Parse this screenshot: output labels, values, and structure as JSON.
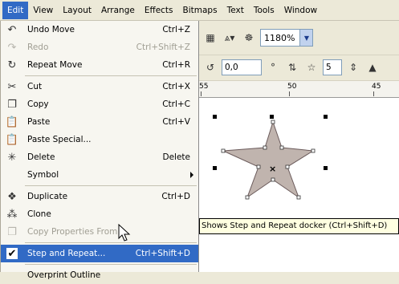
{
  "menubar": {
    "items": [
      "Edit",
      "View",
      "Layout",
      "Arrange",
      "Effects",
      "Bitmaps",
      "Text",
      "Tools",
      "Window"
    ],
    "active": "Edit"
  },
  "toolbar": {
    "zoom_value": "1180%",
    "angle_value": "0,0",
    "angle_unit": "°",
    "points_value": "5"
  },
  "ruler": {
    "labels": [
      "55",
      "50",
      "45"
    ]
  },
  "edit_menu": {
    "items": [
      {
        "label": "Undo Move",
        "shortcut": "Ctrl+Z",
        "icon": "undo-icon",
        "enabled": true
      },
      {
        "label": "Redo",
        "shortcut": "Ctrl+Shift+Z",
        "icon": "redo-icon",
        "enabled": false
      },
      {
        "label": "Repeat Move",
        "shortcut": "Ctrl+R",
        "icon": "repeat-icon",
        "enabled": true
      },
      {
        "label": "Cut",
        "shortcut": "Ctrl+X",
        "icon": "cut-icon",
        "enabled": true
      },
      {
        "label": "Copy",
        "shortcut": "Ctrl+C",
        "icon": "copy-icon",
        "enabled": true
      },
      {
        "label": "Paste",
        "shortcut": "Ctrl+V",
        "icon": "paste-icon",
        "enabled": true
      },
      {
        "label": "Paste Special...",
        "shortcut": "",
        "icon": "paste-special-icon",
        "enabled": true
      },
      {
        "label": "Delete",
        "shortcut": "Delete",
        "icon": "delete-icon",
        "enabled": true
      },
      {
        "label": "Symbol",
        "shortcut": "",
        "icon": "",
        "enabled": true,
        "submenu": true
      },
      {
        "label": "Duplicate",
        "shortcut": "Ctrl+D",
        "icon": "duplicate-icon",
        "enabled": true
      },
      {
        "label": "Clone",
        "shortcut": "",
        "icon": "clone-icon",
        "enabled": true
      },
      {
        "label": "Copy Properties From...",
        "shortcut": "",
        "icon": "copy-properties-icon",
        "enabled": false
      },
      {
        "label": "Step and Repeat...",
        "shortcut": "Ctrl+Shift+D",
        "icon": "check-icon",
        "enabled": true,
        "highlighted": true
      },
      {
        "label": "Overprint Outline",
        "shortcut": "",
        "icon": "",
        "enabled": true
      }
    ]
  },
  "tooltip": {
    "text": "Shows Step and Repeat docker (Ctrl+Shift+D)"
  },
  "colors": {
    "highlight": "#316ac5",
    "star_fill": "#c0b4ae",
    "star_outline": "#6b5b5b",
    "tooltip_bg": "#ffffe1"
  }
}
